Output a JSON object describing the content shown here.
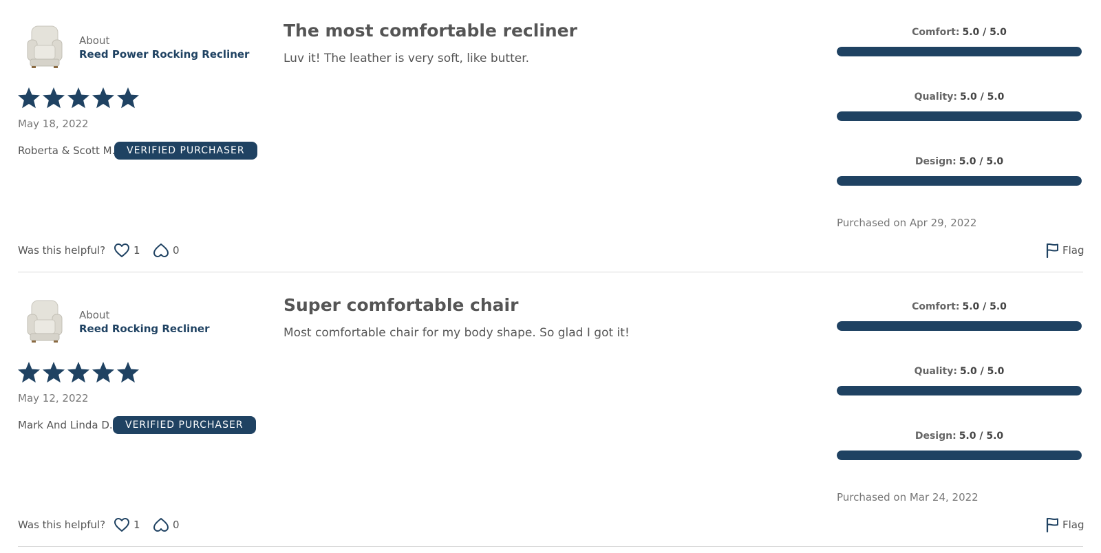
{
  "reviews": [
    {
      "product": {
        "about_label": "About",
        "name": "Reed Power Rocking Recliner",
        "thumbnail_icon": "recliner-chair-image"
      },
      "rating": {
        "stars": 5,
        "max": 5
      },
      "date": "May 18, 2022",
      "reviewer": "Roberta & Scott M.",
      "badge": "VERIFIED PURCHASER",
      "title": "The most comfortable recliner",
      "body": "Luv it! The leather is very soft, like butter.",
      "scores": [
        {
          "label": "Comfort:",
          "value": "5.0 / 5.0",
          "fraction": 1.0
        },
        {
          "label": "Quality:",
          "value": "5.0 / 5.0",
          "fraction": 1.0
        },
        {
          "label": "Design:",
          "value": "5.0 / 5.0",
          "fraction": 1.0
        }
      ],
      "purchased": "Purchased on Apr 29, 2022",
      "helpful": {
        "label": "Was this helpful?",
        "up_count": "1",
        "down_count": "0",
        "up_icon": "heart-icon",
        "down_icon": "broken-heart-icon"
      },
      "flag": {
        "label": "Flag",
        "icon": "flag-icon"
      }
    },
    {
      "product": {
        "about_label": "About",
        "name": "Reed Rocking Recliner",
        "thumbnail_icon": "recliner-chair-image"
      },
      "rating": {
        "stars": 5,
        "max": 5
      },
      "date": "May 12, 2022",
      "reviewer": "Mark And Linda D.",
      "badge": "VERIFIED PURCHASER",
      "title": "Super comfortable chair",
      "body": "Most comfortable chair for my body shape. So glad I got it!",
      "scores": [
        {
          "label": "Comfort:",
          "value": "5.0 / 5.0",
          "fraction": 1.0
        },
        {
          "label": "Quality:",
          "value": "5.0 / 5.0",
          "fraction": 1.0
        },
        {
          "label": "Design:",
          "value": "5.0 / 5.0",
          "fraction": 1.0
        }
      ],
      "purchased": "Purchased on Mar 24, 2022",
      "helpful": {
        "label": "Was this helpful?",
        "up_count": "1",
        "down_count": "0",
        "up_icon": "heart-icon",
        "down_icon": "broken-heart-icon"
      },
      "flag": {
        "label": "Flag",
        "icon": "flag-icon"
      }
    }
  ],
  "colors": {
    "brand_navy": "#1f4262",
    "text_dark": "#444444",
    "text_muted": "#777777",
    "divider": "#d9d9d9"
  }
}
